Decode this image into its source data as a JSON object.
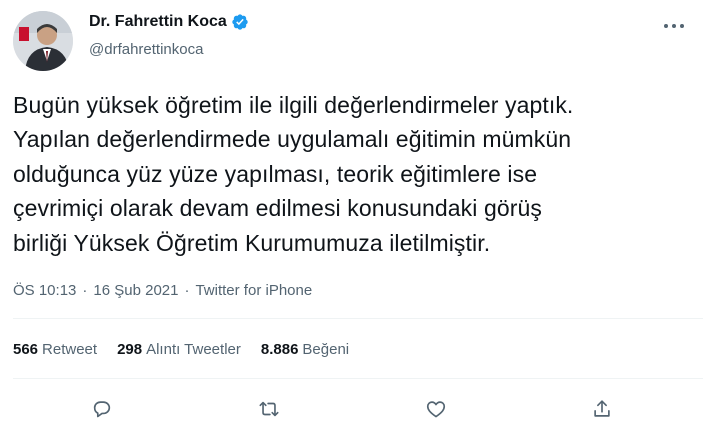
{
  "author": {
    "display_name": "Dr. Fahrettin Koca",
    "handle": "@drfahrettinkoca",
    "verified": true,
    "avatar_icon": "profile-photo"
  },
  "tweet": {
    "text": "Bugün yüksek öğretim ile ilgili değerlendirmeler yaptık.\nYapılan değerlendirmede uygulamalı eğitimin mümkün\nolduğunca yüz yüze yapılması, teorik eğitimlere ise\nçevrimiçi olarak devam edilmesi konusundaki görüş\nbirliği Yüksek Öğretim Kurumumuza iletilmiştir.",
    "time": "ÖS 10:13",
    "date": "16 Şub 2021",
    "separator": "·",
    "source": "Twitter for iPhone"
  },
  "stats": {
    "retweets_count": "566",
    "retweets_label": "Retweet",
    "quotes_count": "298",
    "quotes_label": "Alıntı Tweetler",
    "likes_count": "8.886",
    "likes_label": "Beğeni"
  },
  "actions": {
    "icons": [
      "reply-icon",
      "retweet-icon",
      "like-icon",
      "share-icon"
    ]
  },
  "colors": {
    "text_primary": "#0f1419",
    "text_secondary": "#536471",
    "verified_blue": "#1d9bf0",
    "divider": "#eff3f4"
  }
}
